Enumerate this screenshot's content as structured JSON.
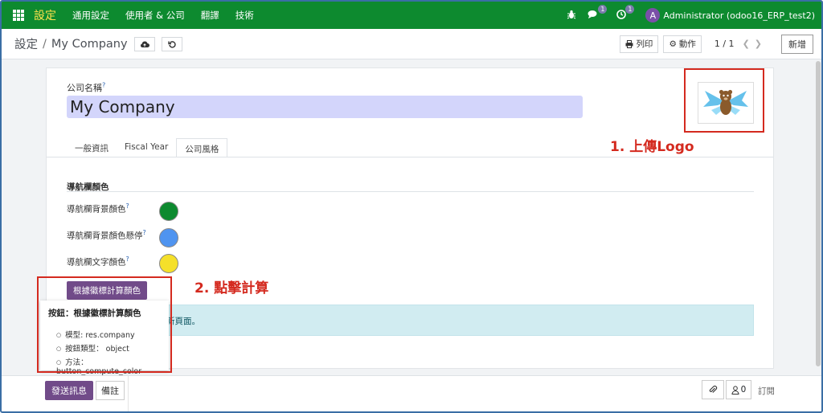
{
  "navbar": {
    "brand": "設定",
    "menu": [
      "通用設定",
      "使用者 & 公司",
      "翻譯",
      "技術"
    ],
    "messages_count": "1",
    "activities_count": "1",
    "avatar_letter": "A",
    "user_label": "Administrator (odoo16_ERP_test2)",
    "background_color": "#0d8a2f"
  },
  "control_panel": {
    "breadcrumb_parent": "設定",
    "breadcrumb_separator": "/",
    "breadcrumb_current": "My Company",
    "print_label": "列印",
    "action_label": "動作",
    "pager": "1 / 1",
    "new_label": "新增"
  },
  "form": {
    "company_name_label": "公司名稱",
    "help_mark": "?",
    "company_name_value": "My Company",
    "tabs": [
      "一般資訊",
      "Fiscal Year",
      "公司風格"
    ],
    "active_tab": "公司風格",
    "section_title": "導航欄顏色",
    "color_fields": [
      {
        "label": "導航欄背景顏色",
        "color": "#0d8a2f"
      },
      {
        "label": "導航欄背景顏色懸停",
        "color": "#4f94f0"
      },
      {
        "label": "導航欄文字顏色",
        "color": "#f5e02a"
      }
    ],
    "compute_button": "根據徽標計算顏色",
    "alert_text": "新頁面。"
  },
  "tooltip": {
    "title": "按鈕：根據徽標計算顏色",
    "rows": [
      "模型: res.company",
      "按鈕類型： object",
      "方法： button_compute_color"
    ]
  },
  "chatter": {
    "send_message": "發送訊息",
    "log_note": "備註",
    "followers_count": "0",
    "subscribe": "訂閱"
  },
  "annotations": {
    "step1": "1. 上傳Logo",
    "step2": "2. 點擊計算",
    "color": "#d42a1f"
  },
  "icons": [
    "apps-grid-icon",
    "bug-icon",
    "chat-icon",
    "clock-icon",
    "cloud-upload-icon",
    "undo-icon",
    "print-icon",
    "gear-icon",
    "chevron-left-icon",
    "chevron-right-icon",
    "paperclip-icon",
    "user-icon"
  ]
}
